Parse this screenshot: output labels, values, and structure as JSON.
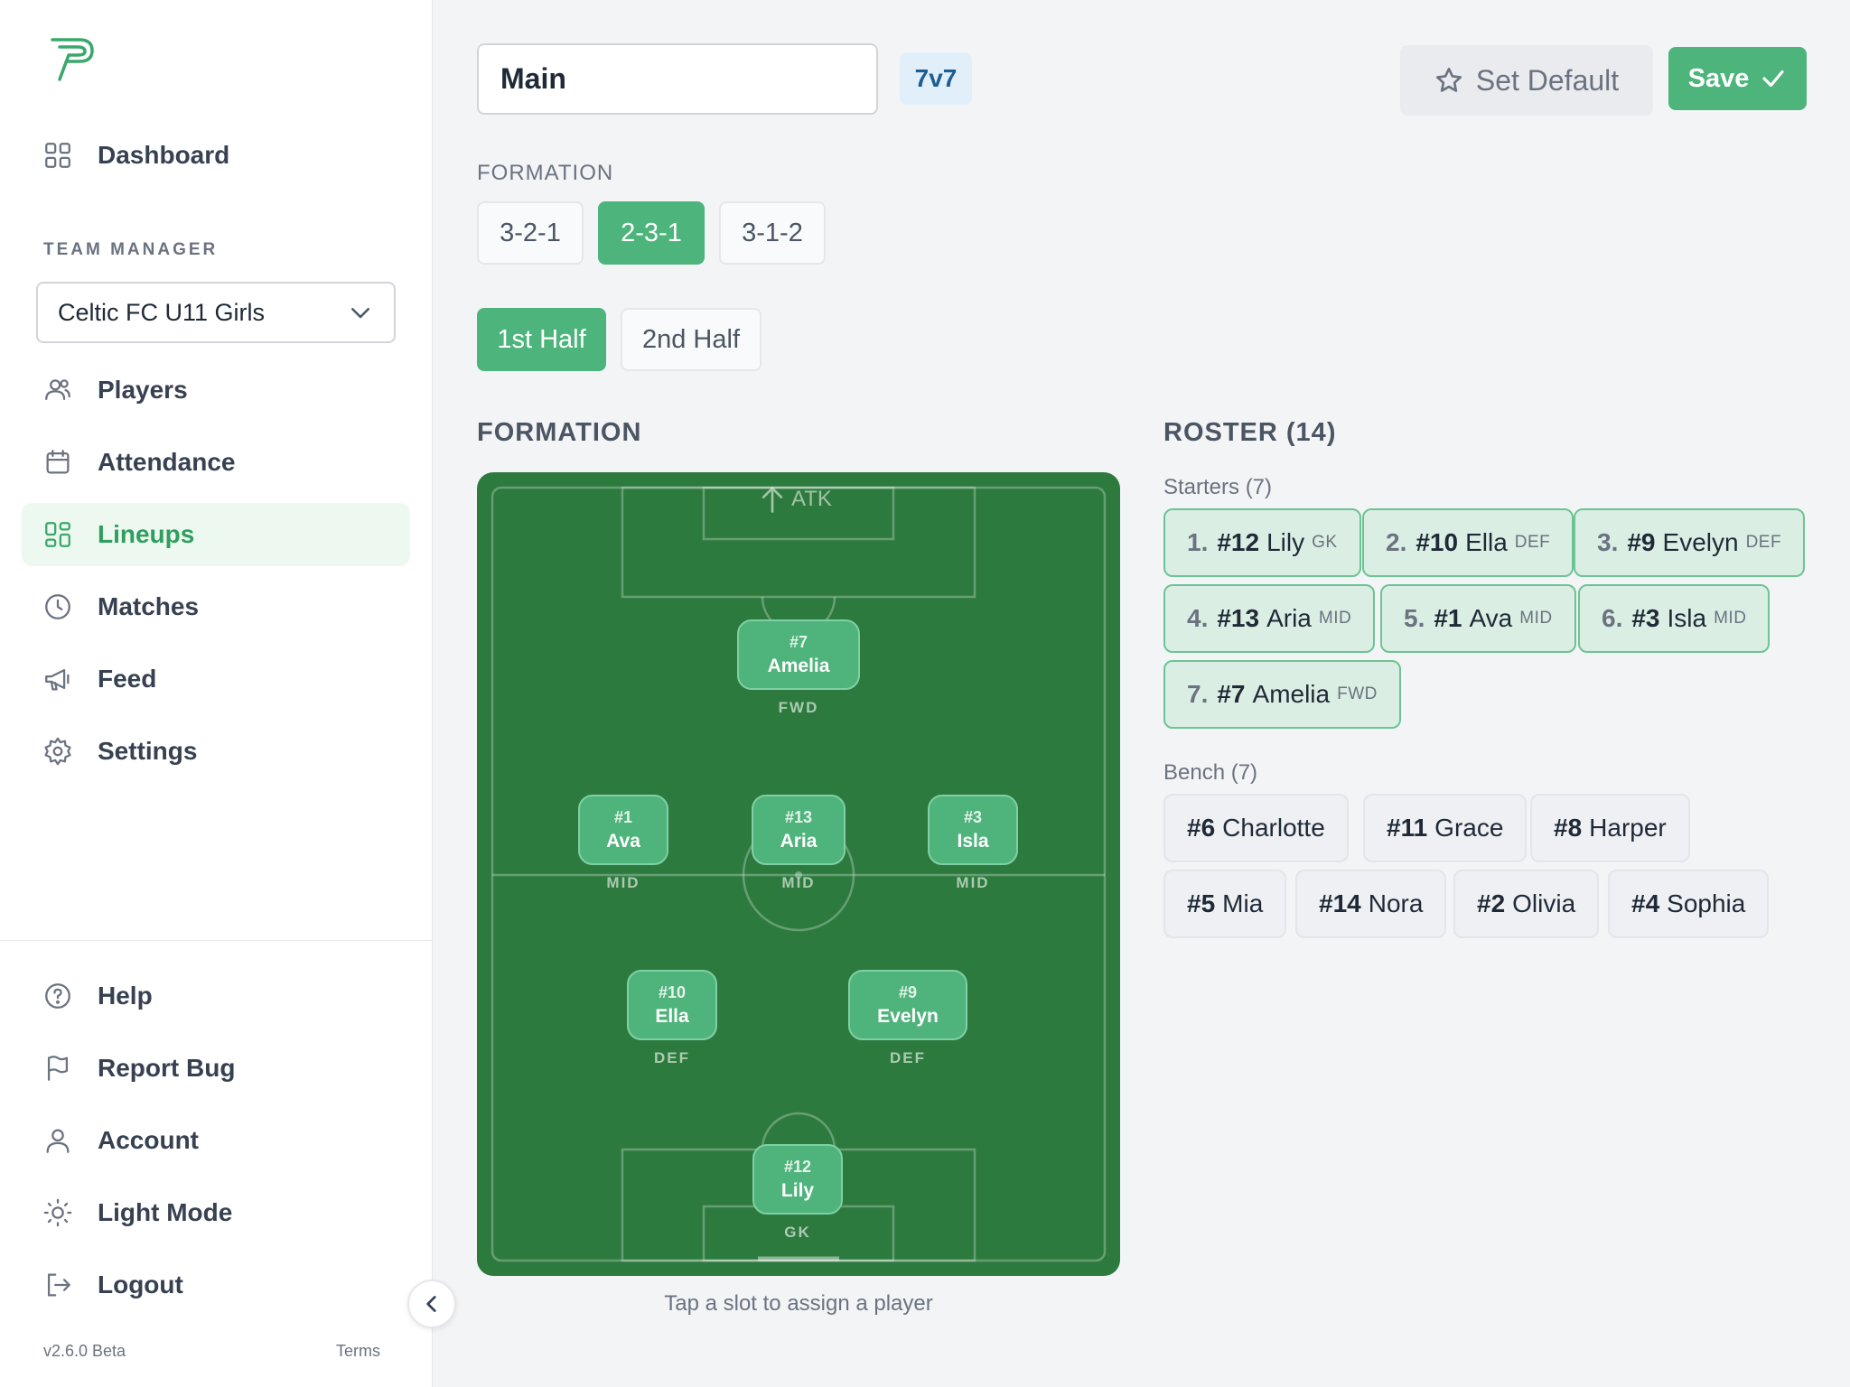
{
  "sidebar": {
    "logo_icon": "p-logo",
    "section_label": "TEAM MANAGER",
    "team_select_value": "Celtic FC U11 Girls",
    "nav": {
      "dashboard": "Dashboard",
      "players": "Players",
      "attendance": "Attendance",
      "lineups": "Lineups",
      "matches": "Matches",
      "feed": "Feed",
      "settings": "Settings"
    },
    "bottom_nav": {
      "help": "Help",
      "report_bug": "Report Bug",
      "account": "Account",
      "light_mode": "Light Mode",
      "logout": "Logout"
    },
    "active_item": "Lineups",
    "version": "v2.6.0 Beta",
    "terms": "Terms"
  },
  "header": {
    "lineup_name": "Main",
    "format_badge": "7v7",
    "set_default_label": "Set Default",
    "save_label": "Save"
  },
  "formation_picker": {
    "label": "FORMATION",
    "options": [
      "3-2-1",
      "2-3-1",
      "3-1-2"
    ],
    "selected": "2-3-1"
  },
  "halves": {
    "options": [
      "1st Half",
      "2nd Half"
    ],
    "selected": "1st Half"
  },
  "pitch": {
    "title": "FORMATION",
    "attack_label": "ATK",
    "hint": "Tap a slot to assign a player",
    "players": {
      "fwd": {
        "num": "#7",
        "name": "Amelia",
        "pos": "FWD"
      },
      "mid_left": {
        "num": "#1",
        "name": "Ava",
        "pos": "MID"
      },
      "mid_center": {
        "num": "#13",
        "name": "Aria",
        "pos": "MID"
      },
      "mid_right": {
        "num": "#3",
        "name": "Isla",
        "pos": "MID"
      },
      "def_left": {
        "num": "#10",
        "name": "Ella",
        "pos": "DEF"
      },
      "def_right": {
        "num": "#9",
        "name": "Evelyn",
        "pos": "DEF"
      },
      "gk": {
        "num": "#12",
        "name": "Lily",
        "pos": "GK"
      }
    }
  },
  "roster": {
    "title": "ROSTER (14)",
    "starters_label": "Starters (7)",
    "starters": [
      {
        "idx": "1.",
        "num": "#12",
        "name": "Lily",
        "pos": "GK"
      },
      {
        "idx": "2.",
        "num": "#10",
        "name": "Ella",
        "pos": "DEF"
      },
      {
        "idx": "3.",
        "num": "#9",
        "name": "Evelyn",
        "pos": "DEF"
      },
      {
        "idx": "4.",
        "num": "#13",
        "name": "Aria",
        "pos": "MID"
      },
      {
        "idx": "5.",
        "num": "#1",
        "name": "Ava",
        "pos": "MID"
      },
      {
        "idx": "6.",
        "num": "#3",
        "name": "Isla",
        "pos": "MID"
      },
      {
        "idx": "7.",
        "num": "#7",
        "name": "Amelia",
        "pos": "FWD"
      }
    ],
    "bench_label": "Bench (7)",
    "bench": [
      {
        "num": "#6",
        "name": "Charlotte"
      },
      {
        "num": "#11",
        "name": "Grace"
      },
      {
        "num": "#8",
        "name": "Harper"
      },
      {
        "num": "#5",
        "name": "Mia"
      },
      {
        "num": "#14",
        "name": "Nora"
      },
      {
        "num": "#2",
        "name": "Olivia"
      },
      {
        "num": "#4",
        "name": "Sophia"
      }
    ]
  },
  "colors": {
    "accent": "#4db57c",
    "pitch": "#2d7a3e",
    "starter_bg": "#dbeee3",
    "badge_bg": "#e0effa"
  }
}
